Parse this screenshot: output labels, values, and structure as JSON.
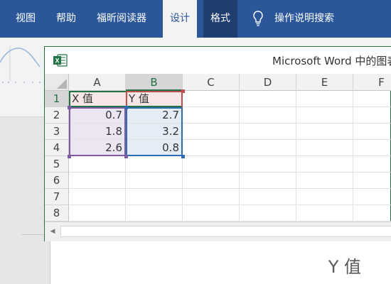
{
  "ribbon": {
    "tabs": [
      {
        "label": "视图"
      },
      {
        "label": "帮助"
      },
      {
        "label": "福昕阅读器"
      },
      {
        "label": "设计"
      },
      {
        "label": "格式"
      }
    ],
    "tell_me": "操作说明搜索"
  },
  "document": {
    "axis_title": "Y 值"
  },
  "excel": {
    "title": "Microsoft Word 中的图表",
    "columns": [
      "A",
      "B",
      "C",
      "D",
      "E",
      "F"
    ],
    "rows": [
      "1",
      "2",
      "3",
      "4",
      "5",
      "6",
      "7",
      "8"
    ],
    "headers": {
      "x": "X 值",
      "y": "Y 值"
    },
    "data": [
      {
        "x": "0.7",
        "y": "2.7"
      },
      {
        "x": "1.8",
        "y": "3.2"
      },
      {
        "x": "2.6",
        "y": "0.8"
      }
    ]
  },
  "colors": {
    "ribbon": "#2b579a",
    "excel_green": "#217346",
    "x_range": "#7f5ba5",
    "y_range": "#2e6db4",
    "header_range": "#c0504d"
  }
}
